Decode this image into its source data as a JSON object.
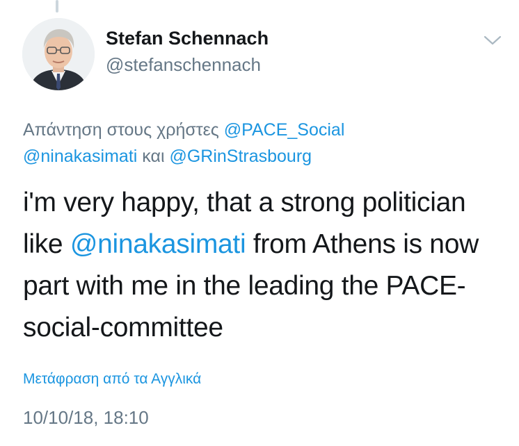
{
  "author": {
    "display_name": "Stefan Schennach",
    "handle": "@stefanschennach"
  },
  "icons": {
    "menu": "chevron-down-icon",
    "avatar": "avatar-portrait"
  },
  "reply_context": {
    "prefix": "Απάντηση στους χρήστες ",
    "mention_1": "@PACE_Social",
    "mention_2": "@ninakasimati",
    "joiner": " και ",
    "mention_3": "@GRinStrasbourg"
  },
  "tweet": {
    "text_before": "i'm very happy, that a strong politician like ",
    "mention": "@ninakasimati",
    "text_after": " from Athens is now part with me in the leading the PACE-social-committee"
  },
  "translate_link": "Μετάφραση από τα Αγγλικά",
  "timestamp": "10/10/18, 18:10",
  "colors": {
    "link": "#1b95e0",
    "secondary_text": "#657786",
    "primary_text": "#14171a"
  }
}
